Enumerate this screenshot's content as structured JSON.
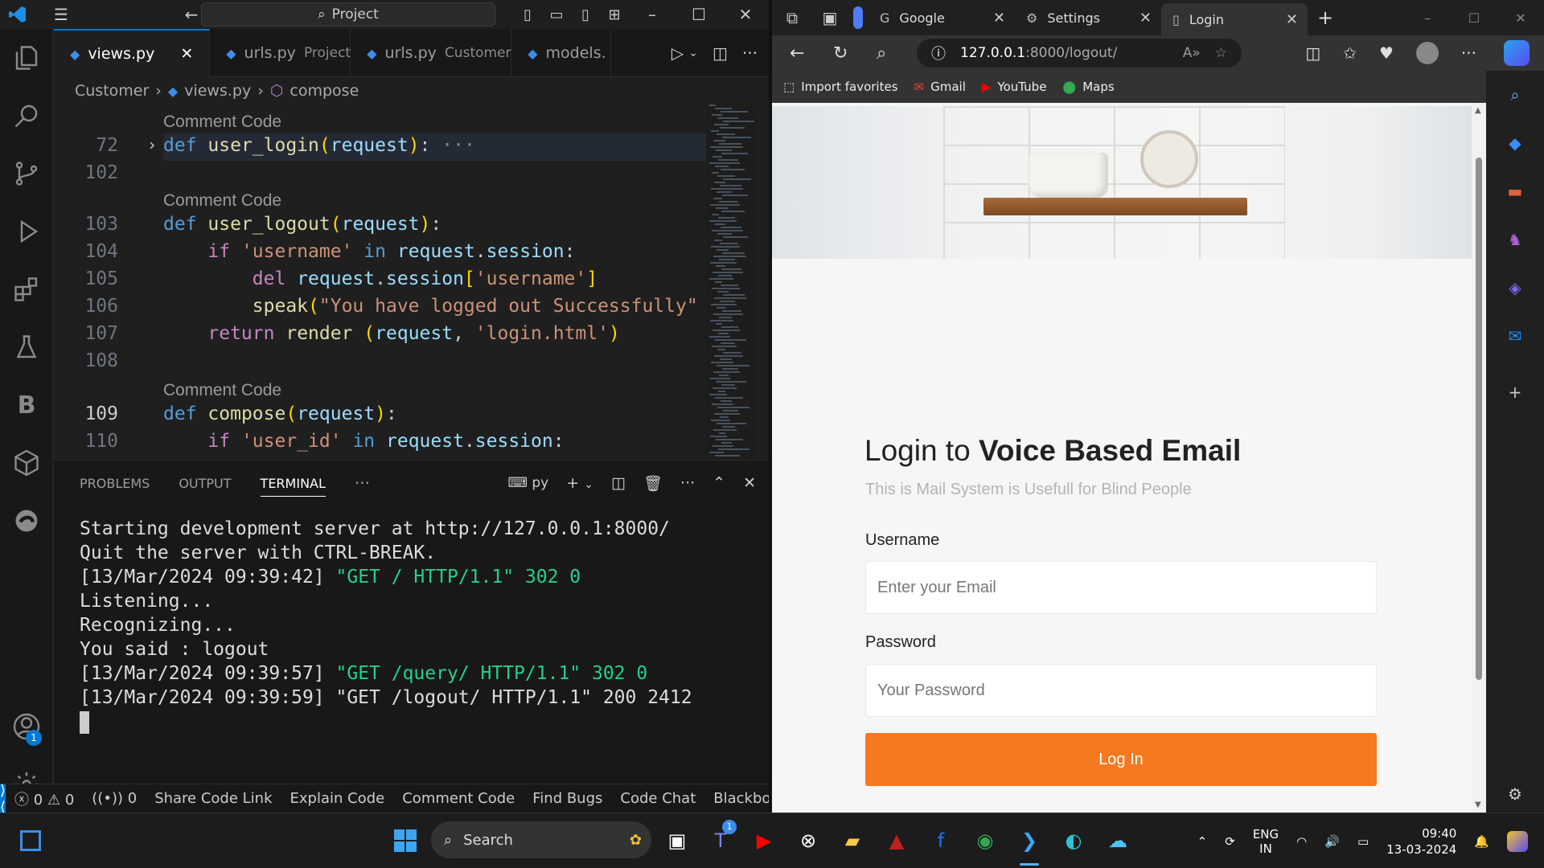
{
  "vscode": {
    "command_center": "Project",
    "tabs": [
      {
        "file": "views.py",
        "detail": ""
      },
      {
        "file": "urls.py",
        "detail": "Project"
      },
      {
        "file": "urls.py",
        "detail": "Customer"
      },
      {
        "file": "models.",
        "detail": ""
      }
    ],
    "breadcrumb": [
      "Customer",
      "views.py",
      "compose"
    ],
    "code_lens": "Comment Code",
    "lines": {
      "n72": "72",
      "n102": "102",
      "n103": "103",
      "n104": "104",
      "n105": "105",
      "n106": "106",
      "n107": "107",
      "n108": "108",
      "n109": "109",
      "n110": "110"
    },
    "panel_tabs": [
      "PROBLEMS",
      "OUTPUT",
      "TERMINAL"
    ],
    "terminal_shell": "py",
    "terminal": {
      "l1": "Starting development server at http://127.0.0.1:8000/",
      "l2": "Quit the server with CTRL-BREAK.",
      "l3_time": "[13/Mar/2024 09:39:42]",
      "l3_req": "\"GET / HTTP/1.1\" 302 0",
      "l4": "Listening...",
      "l5": "Recognizing...",
      "l6": "You said : logout",
      "l7_time": "[13/Mar/2024 09:39:57]",
      "l7_req": "\"GET /query/ HTTP/1.1\" 302 0",
      "l8": "[13/Mar/2024 09:39:59] \"GET /logout/ HTTP/1.1\" 200 2412"
    },
    "status": {
      "errors": "0",
      "warnings": "0",
      "ports": "0",
      "items": [
        "Share Code Link",
        "Explain Code",
        "Comment Code",
        "Find Bugs",
        "Code Chat",
        "Blackbox"
      ]
    },
    "accounts_badge": "1"
  },
  "edge": {
    "tabs": [
      "Google",
      "Settings",
      "Login"
    ],
    "url_host": "127.0.0.1",
    "url_path": ":8000/logout/",
    "favorites": [
      "Import favorites",
      "Gmail",
      "YouTube",
      "Maps"
    ],
    "page": {
      "title_plain": "Login to ",
      "title_bold": "Voice Based Email",
      "subtitle": "This is Mail System is Usefull for Blind People",
      "username_label": "Username",
      "username_placeholder": "Enter your Email",
      "password_label": "Password",
      "password_placeholder": "Your Password",
      "login_button": "Log In"
    }
  },
  "taskbar": {
    "search": "Search",
    "teams_badge": "1",
    "lang1": "ENG",
    "lang2": "IN",
    "time": "09:40",
    "date": "13-03-2024"
  }
}
